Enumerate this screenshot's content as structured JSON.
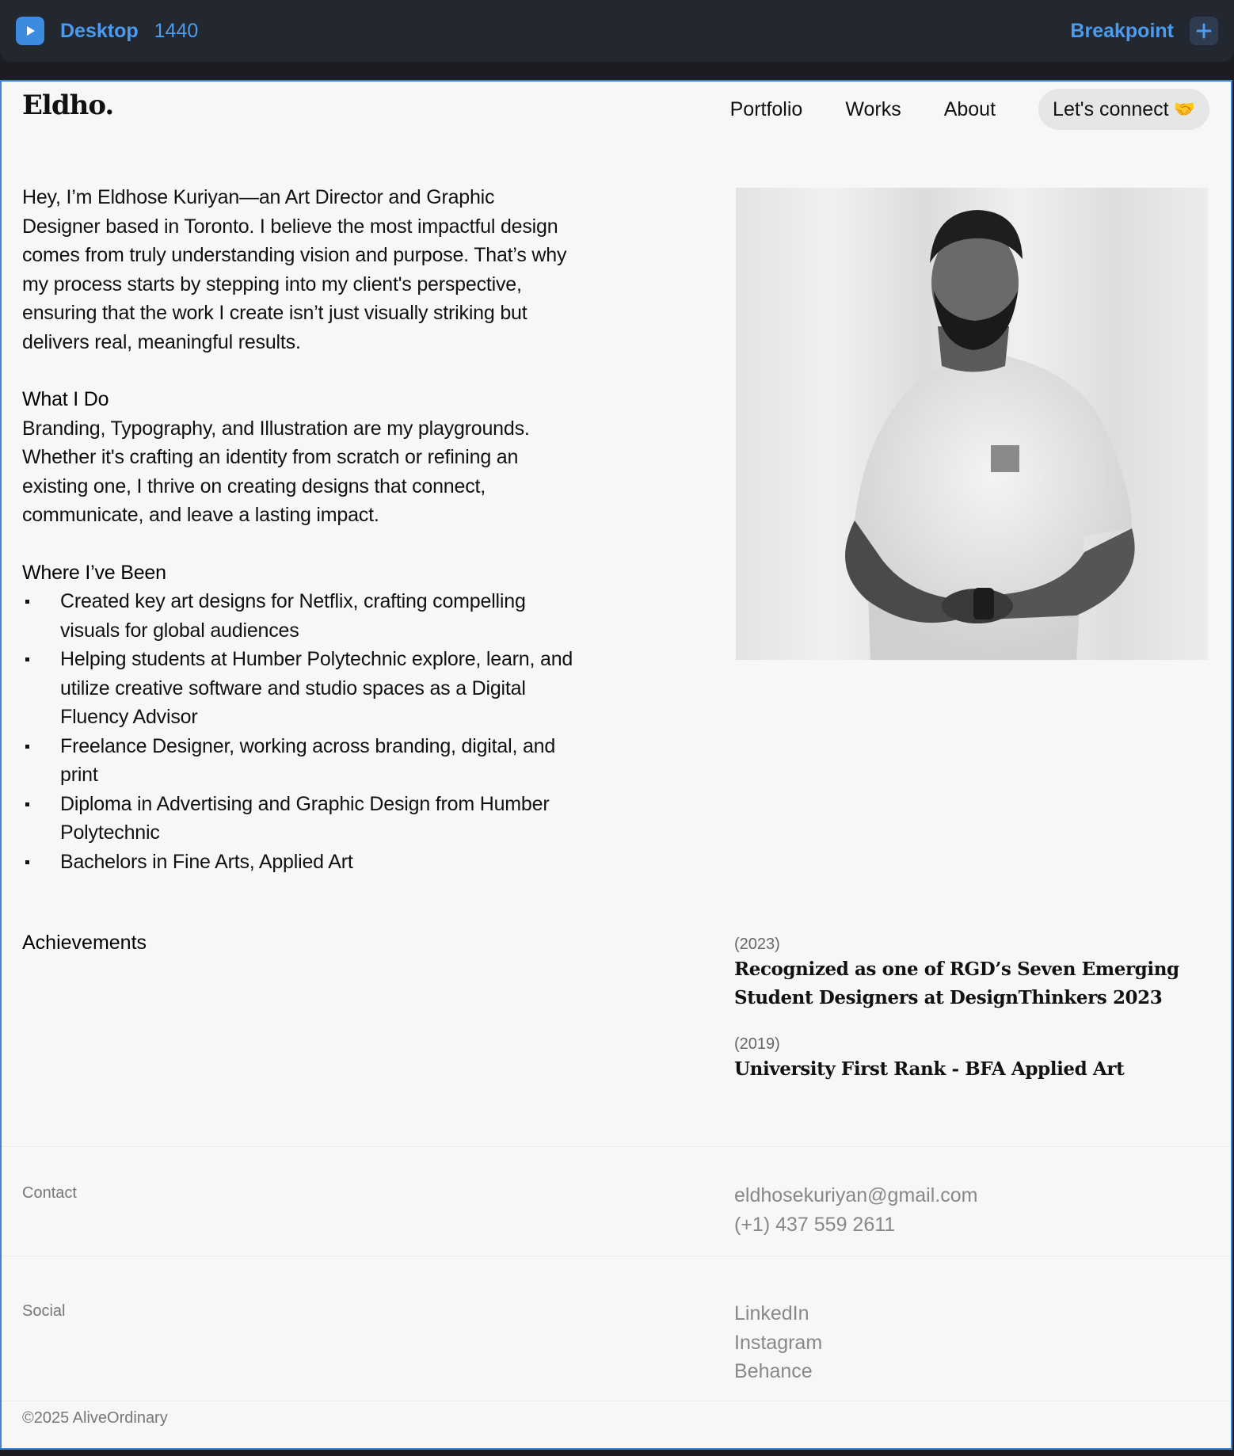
{
  "editor": {
    "breakpoint_name": "Desktop",
    "breakpoint_width": "1440",
    "add_breakpoint_label": "Breakpoint",
    "accent": "#4b9cf0"
  },
  "site": {
    "logo": "Eldho.",
    "nav": {
      "links": [
        "Portfolio",
        "Works",
        "About"
      ],
      "cta_label": "Let's connect",
      "cta_emoji": "🤝"
    },
    "bio": {
      "intro": "Hey, I’m Eldhose Kuriyan—an Art Director and Graphic Designer based in Toronto. I believe the most impactful design comes from truly understanding vision and purpose. That’s why my process starts by stepping into my client's perspective, ensuring that the work I create isn’t just visually striking but delivers real, meaningful results.",
      "what_heading": "What I Do",
      "what_text": "Branding, Typography, and Illustration are my playgrounds. Whether it's crafting an identity from scratch or refining an existing one, I thrive on creating designs that connect, communicate, and leave a lasting impact.",
      "been_heading": "Where I’ve Been",
      "been_items": [
        "Created key art designs for Netflix, crafting compelling visuals for global audiences",
        "Helping students at Humber Polytechnic  explore, learn, and utilize creative software and studio spaces as a Digital Fluency Advisor",
        "Freelance Designer, working across branding, digital, and print",
        "Diploma in Advertising and Graphic Design from Humber Polytechnic",
        "Bachelors in Fine Arts, Applied Art"
      ]
    },
    "achievements": {
      "heading": "Achievements",
      "items": [
        {
          "year": "(2023)",
          "text": "Recognized as one of RGD’s Seven Emerging Student Designers at DesignThinkers 2023"
        },
        {
          "year": "(2019)",
          "text": "University First Rank - BFA Applied Art"
        }
      ]
    },
    "contact": {
      "label": "Contact",
      "email": "eldhosekuriyan@gmail.com",
      "phone": "(+1) 437 559 2611"
    },
    "social": {
      "label": "Social",
      "links": [
        "LinkedIn",
        "Instagram",
        "Behance"
      ]
    },
    "footer": {
      "copyright": "©2025 AliveOrdinary"
    }
  }
}
